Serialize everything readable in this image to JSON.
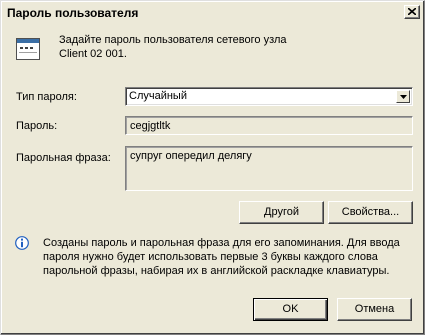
{
  "window": {
    "title": "Пароль пользователя"
  },
  "intro": {
    "line1": "Задайте пароль пользователя сетевого узла",
    "line2": "Client 02 001."
  },
  "fields": {
    "password_type_label": "Тип пароля:",
    "password_type_value": "Случайный",
    "password_label": "Пароль:",
    "password_value": "cegjgtltk",
    "phrase_label": "Парольная фраза:",
    "phrase_value": "супруг опередил делягу"
  },
  "buttons": {
    "other": "Другой",
    "properties": "Свойства...",
    "ok": "OK",
    "cancel": "Отмена"
  },
  "info": {
    "text": "Созданы пароль и парольная фраза для его запоминания. Для ввода пароля нужно будет использовать первые 3 буквы каждого слова парольной фразы, набирая их в английской раскладке клавиатуры."
  },
  "icons": {
    "app": "window-icon",
    "info": "info-icon",
    "close": "close-icon",
    "dropdown": "chevron-down-icon"
  },
  "colors": {
    "face": "#ece9d8",
    "info_icon": "#2060c0"
  }
}
